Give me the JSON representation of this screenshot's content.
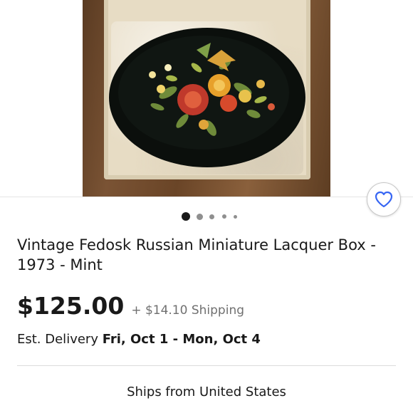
{
  "product": {
    "image_alt": "Oval black lacquer box lid with painted flowers in a cardboard box",
    "title": "Vintage Fedosk Russian Miniature Lacquer Box - 1973 - Mint",
    "price": "$125.00",
    "shipping": "+ $14.10 Shipping",
    "delivery_prefix": "Est. Delivery",
    "delivery_range": "Fri, Oct 1 - Mon, Oct 4",
    "ships_from": "Ships from United States"
  },
  "gallery": {
    "dot_count": 5,
    "active_index": 1
  },
  "icons": {
    "watch": "heart-icon"
  }
}
